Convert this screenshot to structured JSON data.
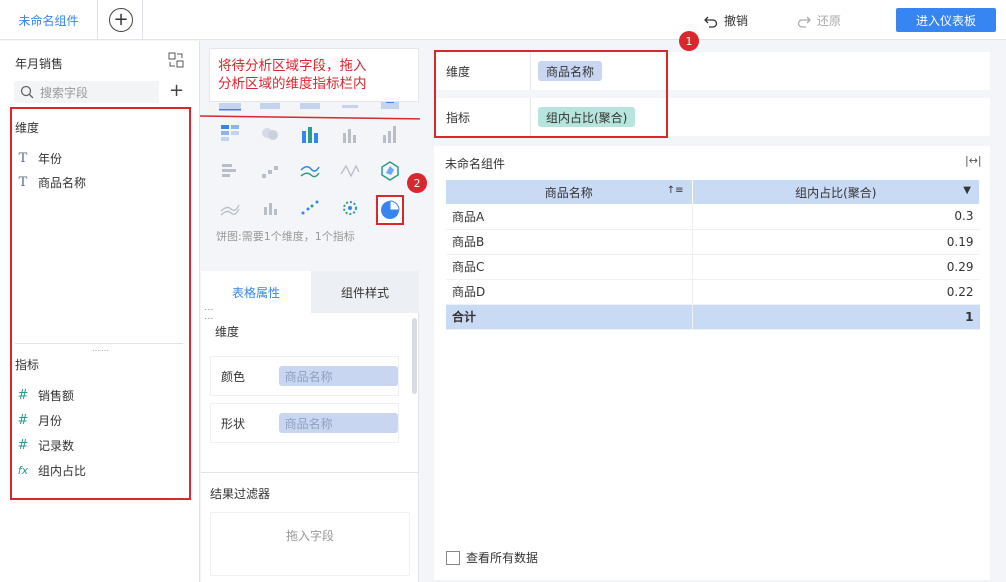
{
  "topbar": {
    "tab_label": "未命名组件",
    "add_tab": "+",
    "undo_label": "撤销",
    "redo_label": "还原",
    "enter_label": "进入仪表板"
  },
  "left": {
    "dataset_name": "年月销售",
    "search_placeholder": "搜索字段",
    "dimension_title": "维度",
    "dimensions": [
      {
        "icon": "T",
        "label": "年份"
      },
      {
        "icon": "T",
        "label": "商品名称"
      }
    ],
    "measure_title": "指标",
    "measures": [
      {
        "icon": "#",
        "label": "销售额"
      },
      {
        "icon": "#",
        "label": "月份"
      },
      {
        "icon": "#",
        "label": "记录数"
      },
      {
        "icon": "fx",
        "label": "组内占比"
      }
    ]
  },
  "middle": {
    "callout_line1": "将待分析区域字段，拖入",
    "callout_line2": "分析区域的维度指标栏内",
    "chart_hint": "饼图:需要1个维度，1个指标",
    "tab_table_props": "表格属性",
    "tab_component_style": "组件样式",
    "props_dim_title": "维度",
    "prop_rows": [
      {
        "label": "颜色",
        "value": "商品名称"
      },
      {
        "label": "形状",
        "value": "商品名称"
      }
    ],
    "filter_title": "结果过滤器",
    "filter_drop": "拖入字段"
  },
  "right": {
    "dim_label": "维度",
    "dim_chip": "商品名称",
    "measure_label": "指标",
    "measure_chip": "组内占比(聚合)",
    "component_title": "未命名组件",
    "badge1": "1",
    "badge2": "2",
    "table": {
      "headers": [
        "商品名称",
        "组内占比(聚合)"
      ],
      "rows": [
        [
          "商品A",
          "0.3"
        ],
        [
          "商品B",
          "0.19"
        ],
        [
          "商品C",
          "0.29"
        ],
        [
          "商品D",
          "0.22"
        ]
      ],
      "total": [
        "合计",
        "1"
      ]
    },
    "see_all_label": "查看所有数据"
  },
  "colors": {
    "accent": "#3685f2",
    "highlight": "#d9272e",
    "dim_chip": "#c9d6f2",
    "measure_chip": "#b7e4dc"
  }
}
